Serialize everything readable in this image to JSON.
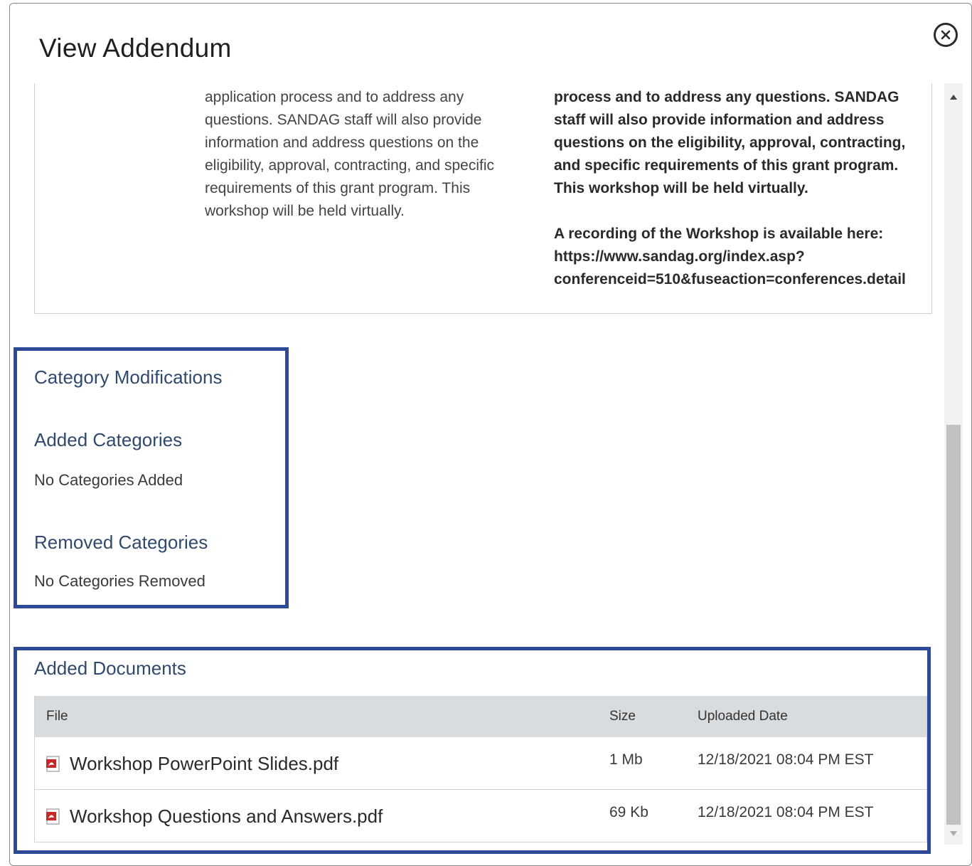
{
  "modal": {
    "title": "View Addendum"
  },
  "description": {
    "old_text": "provide an overview of this call for projects and application process and to address any questions. SANDAG staff will also provide information and address questions on the eligibility, approval, contracting, and specific requirements of this grant program. This workshop will be held virtually.",
    "new_text_p1": "overview of this call for projects and application process and to address any questions. SANDAG staff will also provide information and address questions on the eligibility, approval, contracting, and specific requirements of this grant program. This workshop will be held virtually.",
    "new_text_p2": "A recording of the Workshop is available here: https://www.sandag.org/index.asp?conferenceid=510&fuseaction=conferences.detail"
  },
  "categories": {
    "heading": "Category Modifications",
    "added_heading": "Added Categories",
    "added_value": "No Categories Added",
    "removed_heading": "Removed Categories",
    "removed_value": "No Categories Removed"
  },
  "documents": {
    "heading": "Added Documents",
    "columns": {
      "file": "File",
      "size": "Size",
      "date": "Uploaded Date"
    },
    "rows": [
      {
        "file": "Workshop PowerPoint Slides.pdf",
        "size": "1 Mb",
        "date": "12/18/2021 08:04 PM EST",
        "icon": "pdf-icon"
      },
      {
        "file": "Workshop Questions and Answers.pdf",
        "size": "69 Kb",
        "date": "12/18/2021 08:04 PM EST",
        "icon": "pdf-icon"
      }
    ]
  },
  "colors": {
    "highlight_border": "#2d4a99",
    "heading_text": "#2f4a6e",
    "table_header_bg": "#d9dcdf",
    "pdf_red": "#c62828"
  }
}
